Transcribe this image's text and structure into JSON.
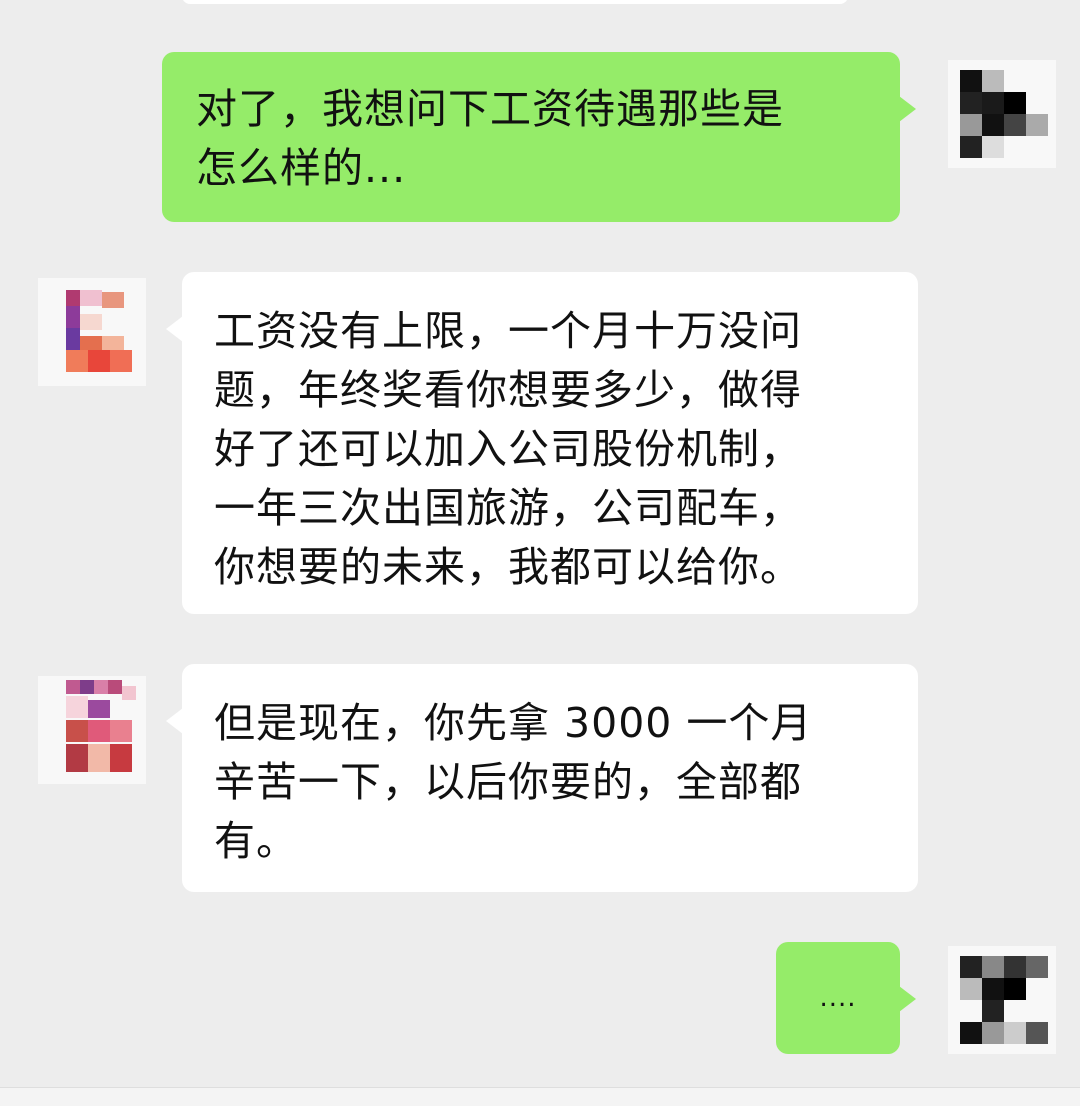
{
  "chat": {
    "messages": [
      {
        "sender": "me",
        "text": "对了，我想问下工资待遇那些是\n怎么样的..."
      },
      {
        "sender": "them",
        "text": "工资没有上限，一个月十万没问\n题，年终奖看你想要多少，做得\n好了还可以加入公司股份机制，\n一年三次出国旅游，公司配车，\n你想要的未来，我都可以给你。"
      },
      {
        "sender": "them",
        "text": "但是现在，你先拿 3000 一个月\n辛苦一下，以后你要的，全部都\n有。"
      },
      {
        "sender": "me",
        "text": "...."
      }
    ]
  },
  "avatars": {
    "me_icon": "pixelated-avatar-icon",
    "them_icon": "pixelated-avatar-icon"
  },
  "colors": {
    "background": "#ededed",
    "my_bubble": "#95ec69",
    "their_bubble": "#ffffff"
  }
}
